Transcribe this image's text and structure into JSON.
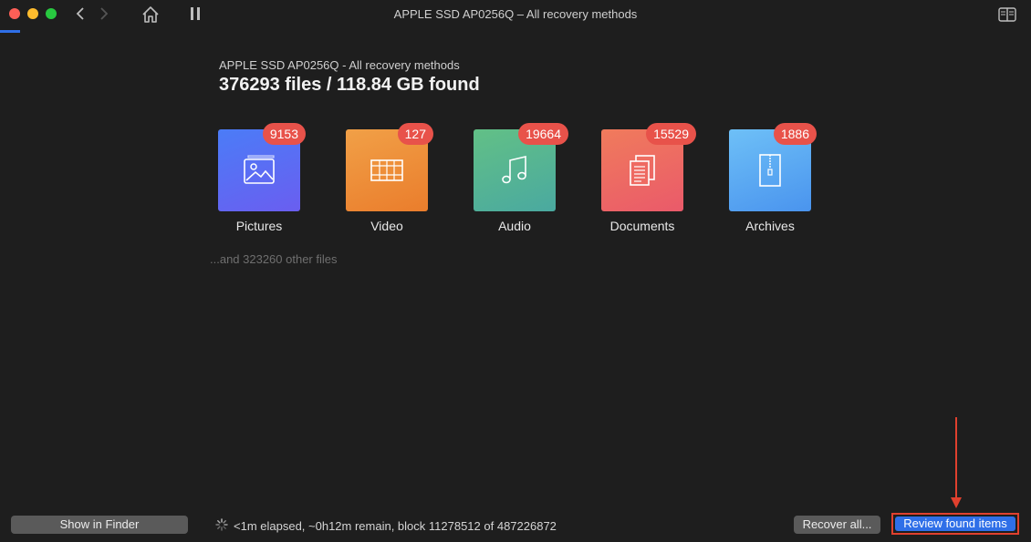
{
  "window": {
    "title": "APPLE SSD AP0256Q – All recovery methods"
  },
  "header": {
    "subtitle": "APPLE SSD AP0256Q - All recovery methods",
    "summary": "376293 files / 118.84 GB found"
  },
  "categories": [
    {
      "label": "Pictures",
      "count": "9153",
      "icon": "image-icon",
      "color": "#5b6cf5"
    },
    {
      "label": "Video",
      "count": "127",
      "icon": "film-icon",
      "color": "#ef8f3a"
    },
    {
      "label": "Audio",
      "count": "19664",
      "icon": "music-note-icon",
      "color": "#55b890"
    },
    {
      "label": "Documents",
      "count": "15529",
      "icon": "documents-icon",
      "color": "#ee6a62"
    },
    {
      "label": "Archives",
      "count": "1886",
      "icon": "zip-archive-icon",
      "color": "#55a5f5"
    }
  ],
  "other_files": "...and 323260 other files",
  "footer": {
    "show_in_finder": "Show in Finder",
    "status": "<1m elapsed, ~0h12m remain, block 11278512 of 487226872",
    "recover_all": "Recover all...",
    "review_found_items": "Review found items"
  },
  "colors": {
    "accent": "#2f6fe8",
    "badge": "#e8524a",
    "highlight": "#e0402e"
  }
}
